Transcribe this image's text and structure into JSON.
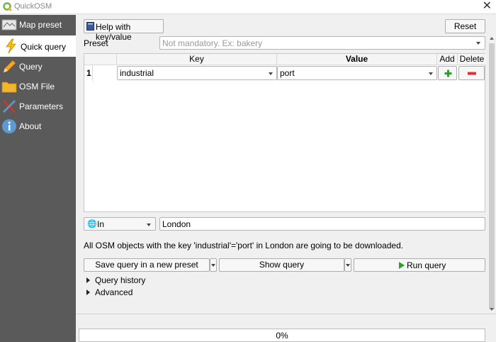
{
  "window": {
    "title": "QuickOSM",
    "close_glyph": "✕"
  },
  "sidebar": {
    "items": [
      {
        "label": "Map preset",
        "icon": "map-icon"
      },
      {
        "label": "Quick query",
        "icon": "lightning-icon",
        "active": true
      },
      {
        "label": "Query",
        "icon": "pencil-icon"
      },
      {
        "label": "OSM File",
        "icon": "folder-icon"
      },
      {
        "label": "Parameters",
        "icon": "tools-icon"
      },
      {
        "label": "About",
        "icon": "info-icon"
      }
    ]
  },
  "toolbar": {
    "help_label": "Help with key/value",
    "reset_label": "Reset"
  },
  "preset": {
    "label": "Preset",
    "placeholder": "Not mandatory. Ex: bakery"
  },
  "table": {
    "headers": {
      "key": "Key",
      "value": "Value",
      "add": "Add",
      "delete": "Delete"
    },
    "rows": [
      {
        "index": "1",
        "key": "industrial",
        "value": "port"
      }
    ]
  },
  "location": {
    "mode": "In",
    "place": "London"
  },
  "summary": "All OSM objects with the key 'industrial'='port' in London are going to be downloaded.",
  "actions": {
    "save_label": "Save query in a new preset",
    "show_label": "Show query",
    "run_label": "Run query"
  },
  "sections": {
    "history": "Query history",
    "advanced": "Advanced"
  },
  "progress": {
    "text": "0%",
    "value": 0
  },
  "colors": {
    "sidebar_bg": "#5a5a5a",
    "add_icon": "#2e9e2e",
    "delete_icon": "#e0303a",
    "run_icon": "#2e9e2e"
  }
}
